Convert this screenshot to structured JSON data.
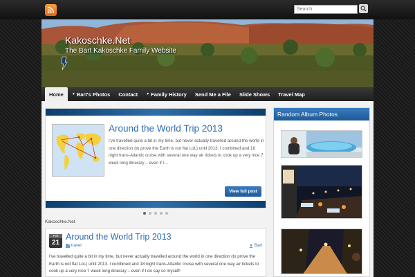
{
  "topbar": {
    "search_placeholder": "Search"
  },
  "header": {
    "site_title": "Kakoschke.Net",
    "tagline": "The Bart Kakoschke Family Website"
  },
  "nav": {
    "items": [
      {
        "label": "Home",
        "active": true,
        "dropdown": false
      },
      {
        "label": "Bart's Photos",
        "active": false,
        "dropdown": true
      },
      {
        "label": "Contact",
        "active": false,
        "dropdown": false
      },
      {
        "label": "Family History",
        "active": false,
        "dropdown": true
      },
      {
        "label": "Send Me a File",
        "active": false,
        "dropdown": false
      },
      {
        "label": "Slide Shows",
        "active": false,
        "dropdown": false
      },
      {
        "label": "Travel Map",
        "active": false,
        "dropdown": false
      }
    ]
  },
  "featured": {
    "title": "Around the World Trip 2013",
    "excerpt": "I've travelled quite a bit in my time, but never actually travelled around the world in one direction (to prove the Earth is not flat LoL) until 2013. I combined and 18 night trans-Atlantic cruise with several one way air tickets to cook up a very nice 7 week long itinerary – even if I…",
    "button_label": "View full post",
    "slides_total": 5,
    "slide_active": 1
  },
  "breadcrumb": "Kakoschke.Net",
  "post": {
    "month": "Feb",
    "day": "21",
    "title": "Around the World Trip 2013",
    "category": "travel",
    "author": "Bart",
    "text": "I've travelled quite a bit in my time, but never actually travelled around the world in one direction (to prove the Earth is not flat LoL) until 2013. I combined and 18 night trans-Atlantic cruise with several one way air tickets to cook up a very nice 7 week long itinerary – even if I do say so myself!"
  },
  "sidebar": {
    "title": "Random Album Photos"
  },
  "colors": {
    "accent": "#2d6bb0",
    "nav_bg": "#1e1e1e",
    "rss": "#e2661c"
  }
}
